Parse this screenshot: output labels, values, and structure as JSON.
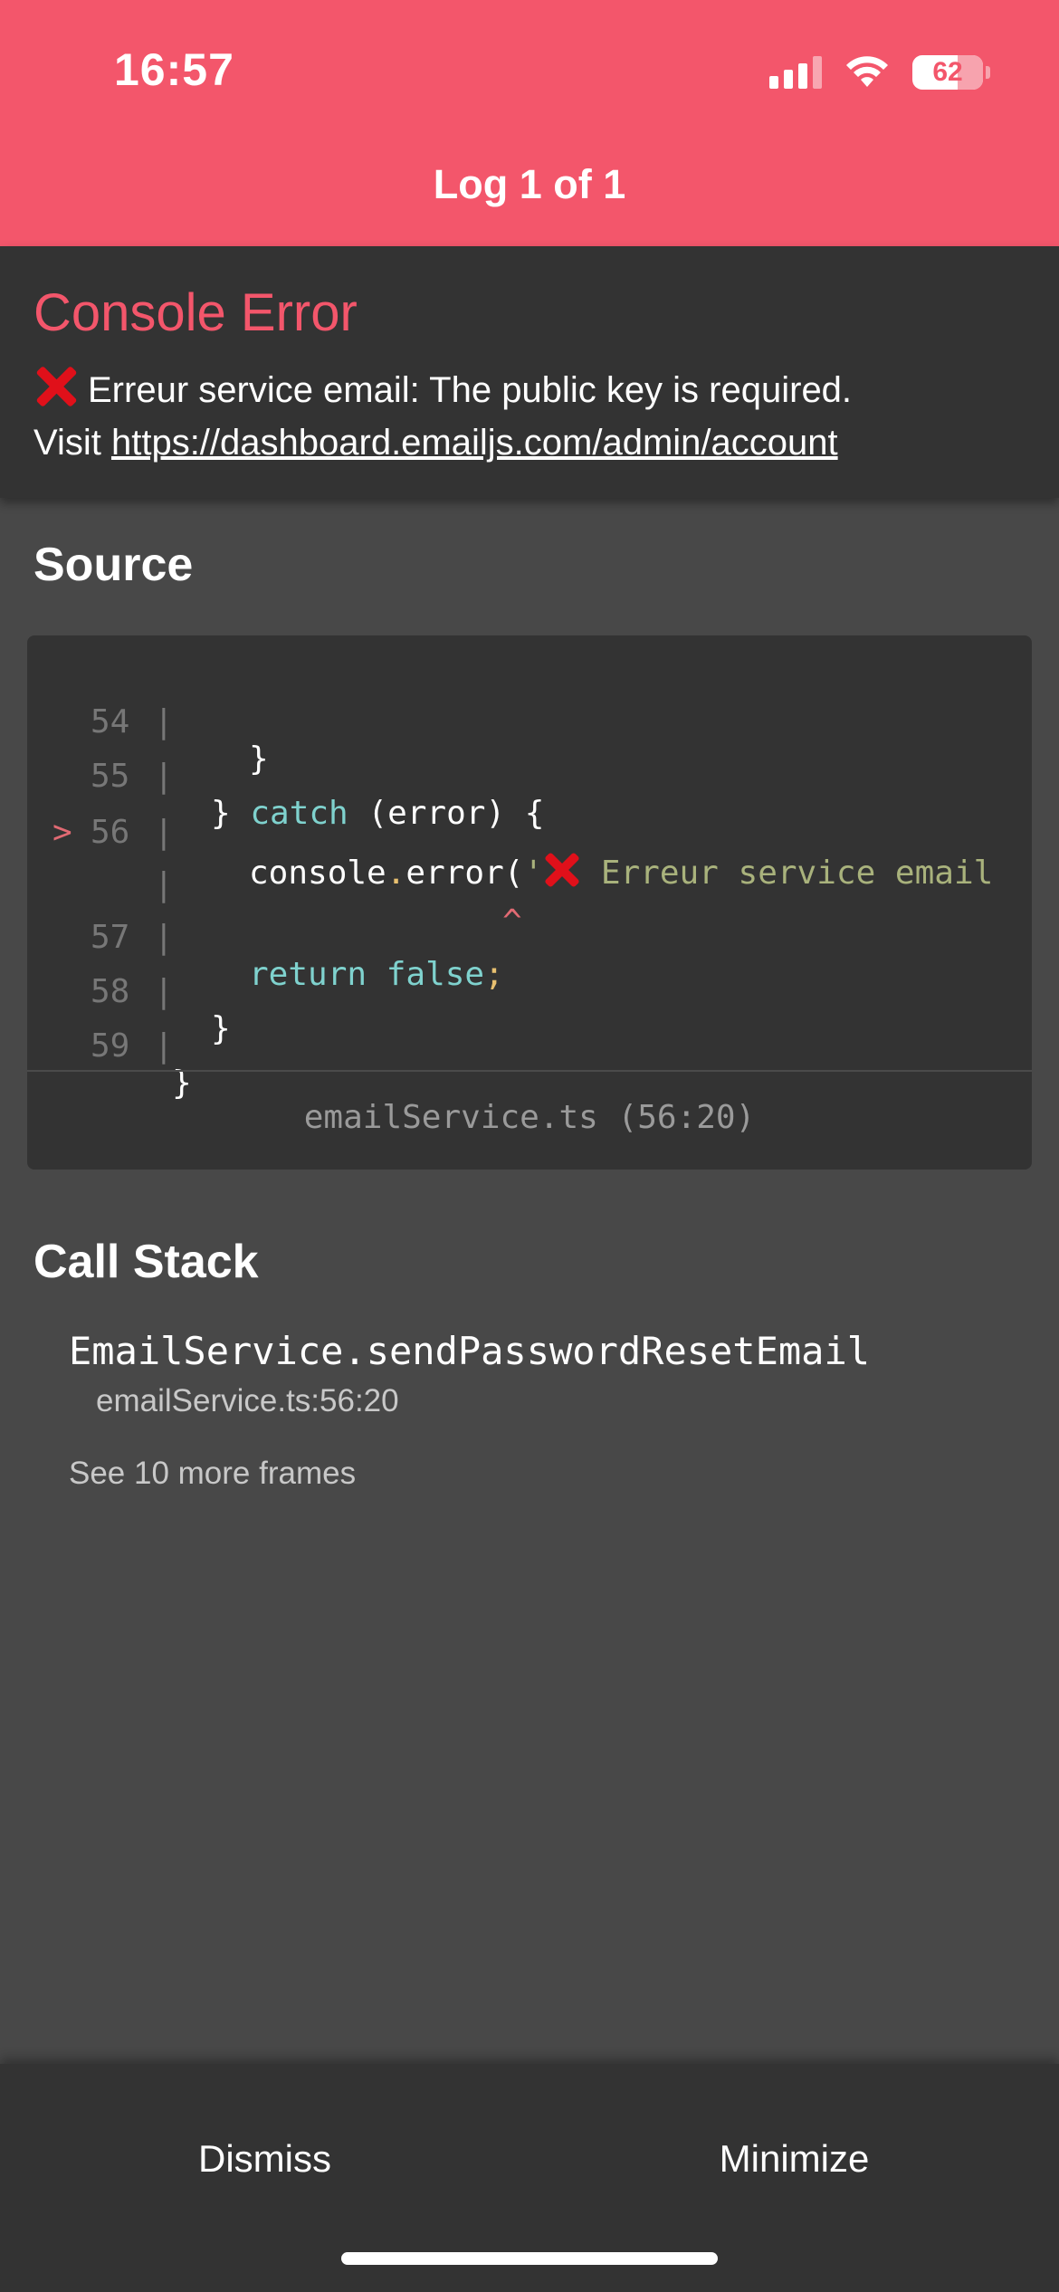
{
  "status_bar": {
    "time": "16:57",
    "battery": "62",
    "icons": [
      "cellular-signal-icon",
      "wifi-icon",
      "battery-icon"
    ]
  },
  "header": {
    "title": "Log 1 of 1"
  },
  "error": {
    "title": "Console Error",
    "message": "Erreur service email: The public key is required.",
    "visit_label": "Visit",
    "link": "https://dashboard.emailjs.com/admin/account"
  },
  "source": {
    "title": "Source",
    "lines": [
      {
        "marker": "",
        "number": "54",
        "code": "  }"
      },
      {
        "marker": "",
        "number": "55",
        "code": "} catch (error) {"
      },
      {
        "marker": ">",
        "number": "56",
        "code": "  console.error('❌ Erreur service email"
      },
      {
        "marker": "",
        "number": "",
        "code": "^"
      },
      {
        "marker": "",
        "number": "57",
        "code": "  return false;"
      },
      {
        "marker": "",
        "number": "58",
        "code": "}"
      },
      {
        "marker": "",
        "number": "59",
        "code": "}"
      }
    ],
    "file_location": "emailService.ts (56:20)"
  },
  "call_stack": {
    "title": "Call Stack",
    "frames": [
      {
        "function": "EmailService.sendPasswordResetEmail",
        "location": "emailService.ts:56:20"
      }
    ],
    "more_frames_label": "See 10 more frames"
  },
  "footer": {
    "dismiss_label": "Dismiss",
    "minimize_label": "Minimize"
  },
  "colors": {
    "header_bg": "#f3566b",
    "error_title": "#f3566b",
    "panel_bg": "#333333",
    "page_bg": "#484848",
    "keyword": "#7fd2ce",
    "string": "#a9b27c"
  }
}
